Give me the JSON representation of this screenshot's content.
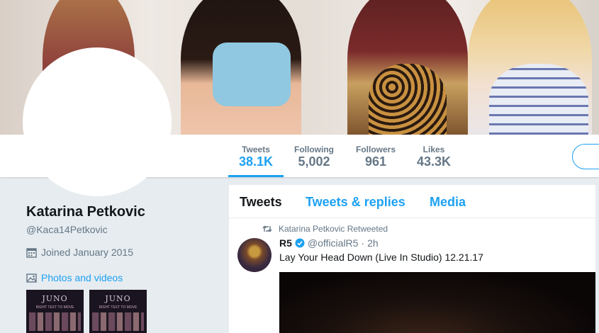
{
  "profile": {
    "name": "Katarina Petkovic",
    "handle": "@Kaca14Petkovic",
    "joined": "Joined January 2015",
    "photos_link": "Photos and videos",
    "thumb_title": "JUNO",
    "thumb_subtitle": "RIGHT TEXT TO MOVE"
  },
  "stats": [
    {
      "label": "Tweets",
      "value": "38.1K",
      "active": true
    },
    {
      "label": "Following",
      "value": "5,002"
    },
    {
      "label": "Followers",
      "value": "961"
    },
    {
      "label": "Likes",
      "value": "43.3K"
    }
  ],
  "timeline": {
    "tabs": [
      "Tweets",
      "Tweets & replies",
      "Media"
    ],
    "retweet_context": "Katarina Petkovic Retweeted",
    "tweet": {
      "author": "R5",
      "handle": "@officialR5",
      "separator": "·",
      "time": "2h",
      "text": "Lay Your Head Down (Live In Studio) 12.21.17",
      "verified": true
    }
  },
  "icons": {
    "calendar": "calendar-icon",
    "photo": "photo-icon",
    "retweet": "retweet-icon",
    "verified": "verified-badge-icon"
  },
  "colors": {
    "accent": "#1da1f2",
    "secondary_text": "#657786",
    "page_bg": "#e6ecf0"
  }
}
